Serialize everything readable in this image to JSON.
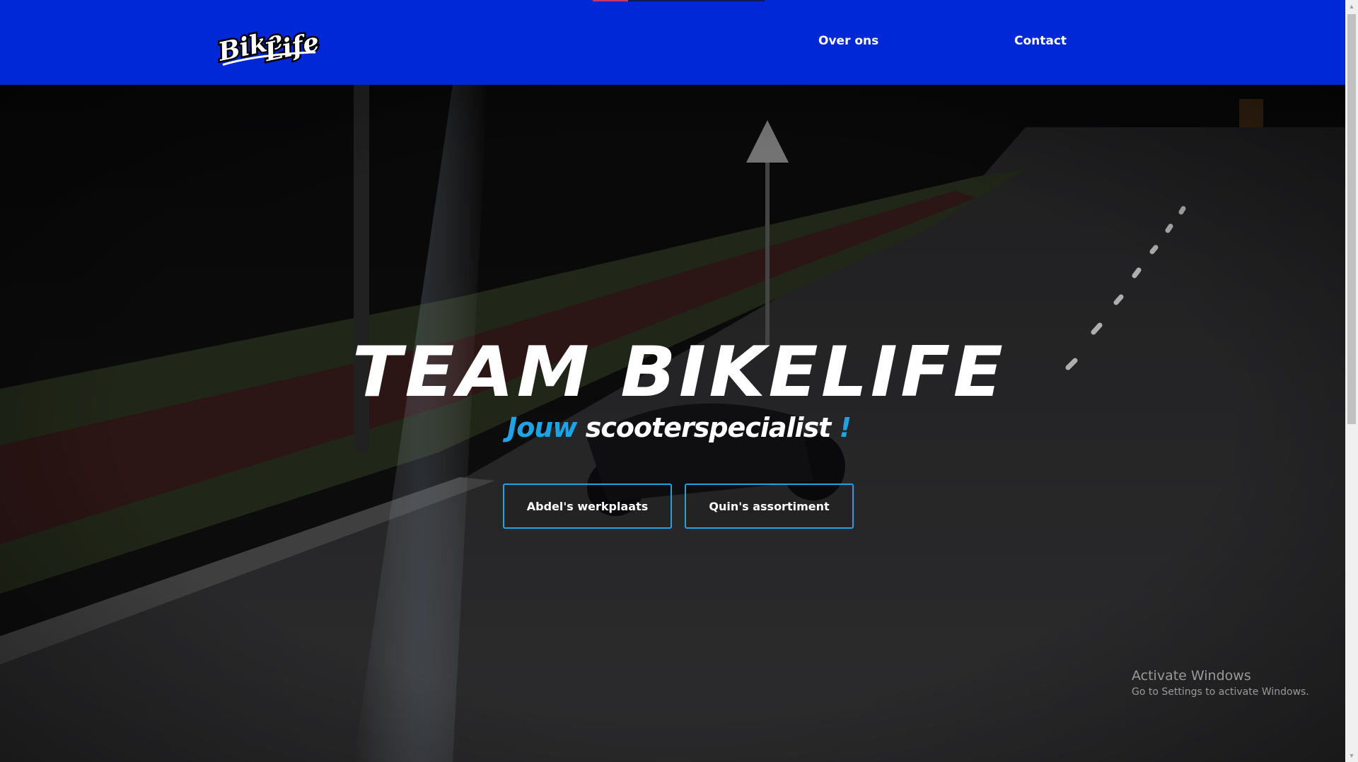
{
  "header": {
    "logo_text": "BikeLife",
    "nav": [
      {
        "label": "Over ons"
      },
      {
        "label": "Contact"
      }
    ]
  },
  "hero": {
    "title": "TEAM BIKELIFE",
    "subtitle_accent": "Jouw",
    "subtitle_main": " scooterspecialist ",
    "subtitle_end": "!",
    "buttons": [
      {
        "label": "Abdel's werkplaats"
      },
      {
        "label": "Quin's assortiment"
      }
    ]
  },
  "watermark": {
    "line1": "Activate Windows",
    "line2": "Go to Settings to activate Windows."
  },
  "colors": {
    "header_bg": "#0028d6",
    "accent": "#1ea3e3",
    "text": "#ffffff"
  },
  "icons": [
    "bikelife-logo",
    "scroll-up-arrow-icon",
    "scroll-down-arrow-icon"
  ]
}
